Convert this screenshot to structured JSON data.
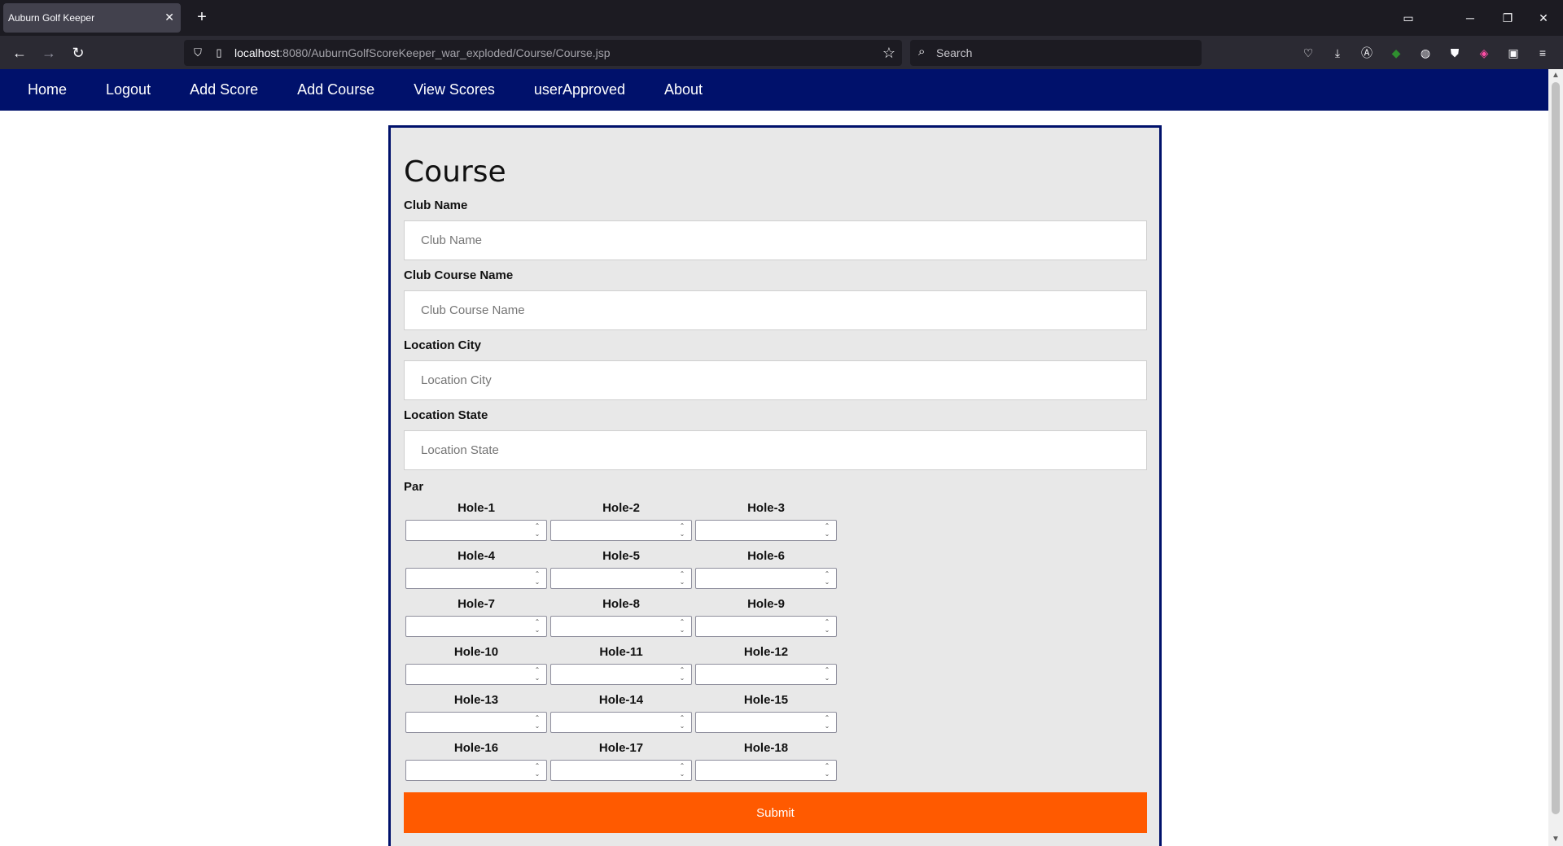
{
  "browser": {
    "tab_title": "Auburn Golf Keeper",
    "tab_close": "✕",
    "new_tab": "+",
    "url_host": "localhost",
    "url_rest": ":8080/AuburnGolfScoreKeeper_war_exploded/Course/Course.jsp",
    "search_placeholder": "Search",
    "icons": [
      "back-icon",
      "forward-icon",
      "reload-icon",
      "shield-icon",
      "page-icon",
      "star-icon",
      "search-icon",
      "pocket-icon",
      "download-icon",
      "account-icon",
      "extension-icon",
      "extension-icon",
      "extension-icon",
      "extension-icon",
      "extension-icon",
      "menu-icon"
    ]
  },
  "nav": {
    "items": [
      "Home",
      "Logout",
      "Add Score",
      "Add Course",
      "View Scores",
      "userApproved",
      "About"
    ]
  },
  "form": {
    "title": "Course",
    "fields": [
      {
        "label": "Club Name",
        "placeholder": "Club Name",
        "value": ""
      },
      {
        "label": "Club Course Name",
        "placeholder": "Club Course Name",
        "value": ""
      },
      {
        "label": "Location City",
        "placeholder": "Location City",
        "value": ""
      },
      {
        "label": "Location State",
        "placeholder": "Location State",
        "value": ""
      }
    ],
    "par_label": "Par",
    "holes": [
      "Hole-1",
      "Hole-2",
      "Hole-3",
      "Hole-4",
      "Hole-5",
      "Hole-6",
      "Hole-7",
      "Hole-8",
      "Hole-9",
      "Hole-10",
      "Hole-11",
      "Hole-12",
      "Hole-13",
      "Hole-14",
      "Hole-15",
      "Hole-16",
      "Hole-17",
      "Hole-18"
    ],
    "submit_label": "Submit"
  },
  "colors": {
    "nav_bg": "#00116b",
    "card_border": "#00116b",
    "submit_bg": "#ff5a00",
    "card_bg": "#e8e8e8"
  }
}
